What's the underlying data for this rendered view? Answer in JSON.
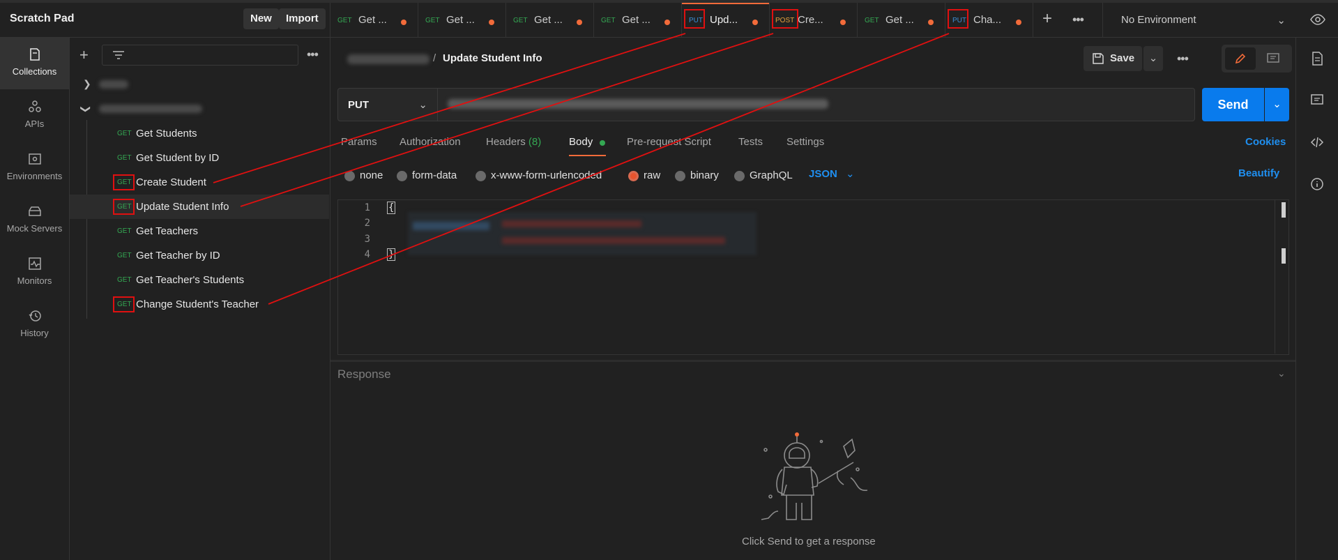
{
  "app": {
    "title": "Scratch Pad",
    "new_label": "New",
    "import_label": "Import"
  },
  "nav": [
    {
      "label": "Collections",
      "icon": "collections-icon"
    },
    {
      "label": "APIs",
      "icon": "apis-icon"
    },
    {
      "label": "Environments",
      "icon": "environments-icon"
    },
    {
      "label": "Mock Servers",
      "icon": "mock-servers-icon"
    },
    {
      "label": "Monitors",
      "icon": "monitors-icon"
    },
    {
      "label": "History",
      "icon": "history-icon"
    }
  ],
  "tabs": [
    {
      "method": "GET",
      "name": "Get ..."
    },
    {
      "method": "GET",
      "name": "Get ..."
    },
    {
      "method": "GET",
      "name": "Get ..."
    },
    {
      "method": "GET",
      "name": "Get ..."
    },
    {
      "method": "PUT",
      "name": "Upd..."
    },
    {
      "method": "POST",
      "name": "Cre..."
    },
    {
      "method": "GET",
      "name": "Get ..."
    },
    {
      "method": "PUT",
      "name": "Cha..."
    }
  ],
  "environment": "No Environment",
  "tree": {
    "requests": [
      {
        "method": "GET",
        "name": "Get Students"
      },
      {
        "method": "GET",
        "name": "Get Student by ID"
      },
      {
        "method": "GET",
        "name": "Create Student"
      },
      {
        "method": "GET",
        "name": "Update Student Info"
      },
      {
        "method": "GET",
        "name": "Get Teachers"
      },
      {
        "method": "GET",
        "name": "Get Teacher by ID"
      },
      {
        "method": "GET",
        "name": "Get Teacher's Students"
      },
      {
        "method": "GET",
        "name": "Change Student's Teacher"
      }
    ]
  },
  "request": {
    "breadcrumb_sep": "/",
    "title": "Update Student Info",
    "save_label": "Save",
    "method": "PUT",
    "send_label": "Send",
    "tabs": {
      "params": "Params",
      "authorization": "Authorization",
      "headers": "Headers",
      "headers_count": "(8)",
      "body": "Body",
      "prerequest": "Pre-request Script",
      "tests": "Tests",
      "settings": "Settings"
    },
    "cookies_label": "Cookies",
    "body_types": [
      "none",
      "form-data",
      "x-www-form-urlencoded",
      "raw",
      "binary",
      "GraphQL"
    ],
    "body_type_selected": "raw",
    "format": "JSON",
    "beautify_label": "Beautify",
    "line_numbers": [
      "1",
      "2",
      "3",
      "4"
    ],
    "open_brace": "{",
    "close_brace": "}"
  },
  "response": {
    "title": "Response",
    "empty_message": "Click Send to get a response"
  },
  "colors": {
    "accent": "#f26b3a",
    "send_blue": "#097bed",
    "link_blue": "#1f8ff0",
    "get_green": "#34a853",
    "put_blue": "#3a8fd8",
    "post_orange": "#e6a23c",
    "annotation_red": "#e01010"
  }
}
